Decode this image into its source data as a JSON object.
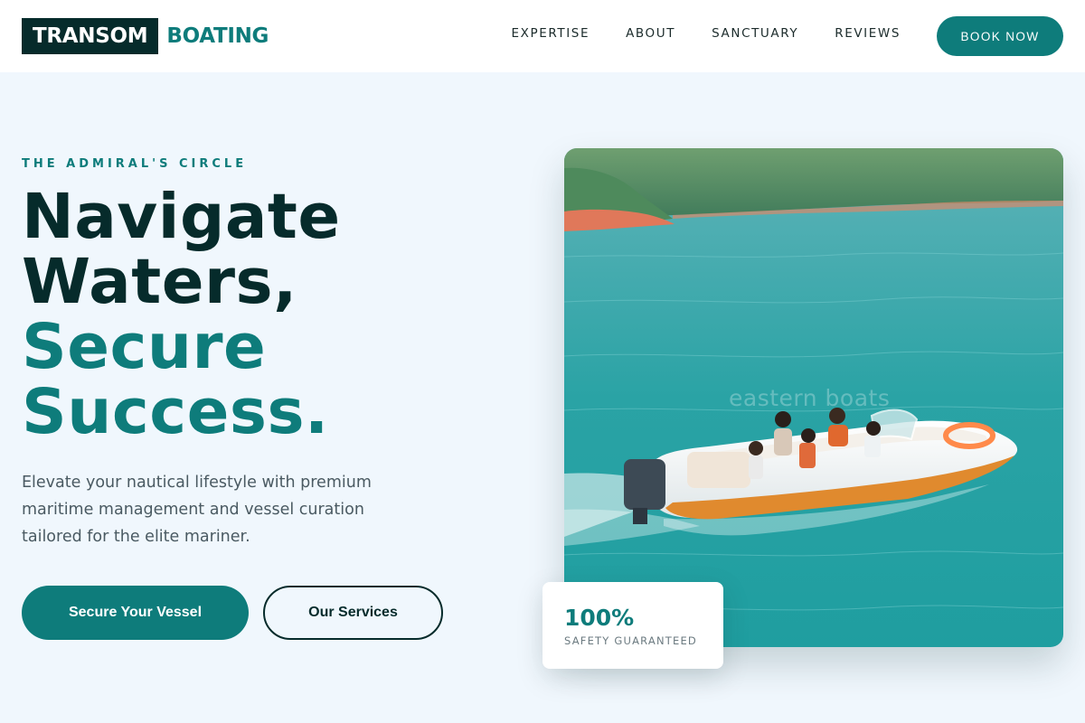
{
  "brand": {
    "logo_box_text": "TRANSOM",
    "logo_text": "BOATING",
    "colors": {
      "primary": "#0e7c7b",
      "dark": "#062b2b",
      "background": "#f0f7fd"
    }
  },
  "nav": {
    "links": [
      "EXPERTISE",
      "ABOUT",
      "SANCTUARY",
      "REVIEWS"
    ],
    "cta": "BOOK NOW"
  },
  "hero": {
    "eyebrow": "THE ADMIRAL'S CIRCLE",
    "headline_line1": "Navigate",
    "headline_line2": "Waters,",
    "headline_line3": "Secure",
    "headline_line4": "Success.",
    "subcopy": "Elevate your nautical lifestyle with premium maritime management and vessel curation tailored for the elite mariner.",
    "primary_button": "Secure Your Vessel",
    "secondary_button": "Our Services",
    "image_watermark": "eastern boats"
  },
  "stat": {
    "value": "100%",
    "label": "SAFETY GUARANTEED"
  }
}
